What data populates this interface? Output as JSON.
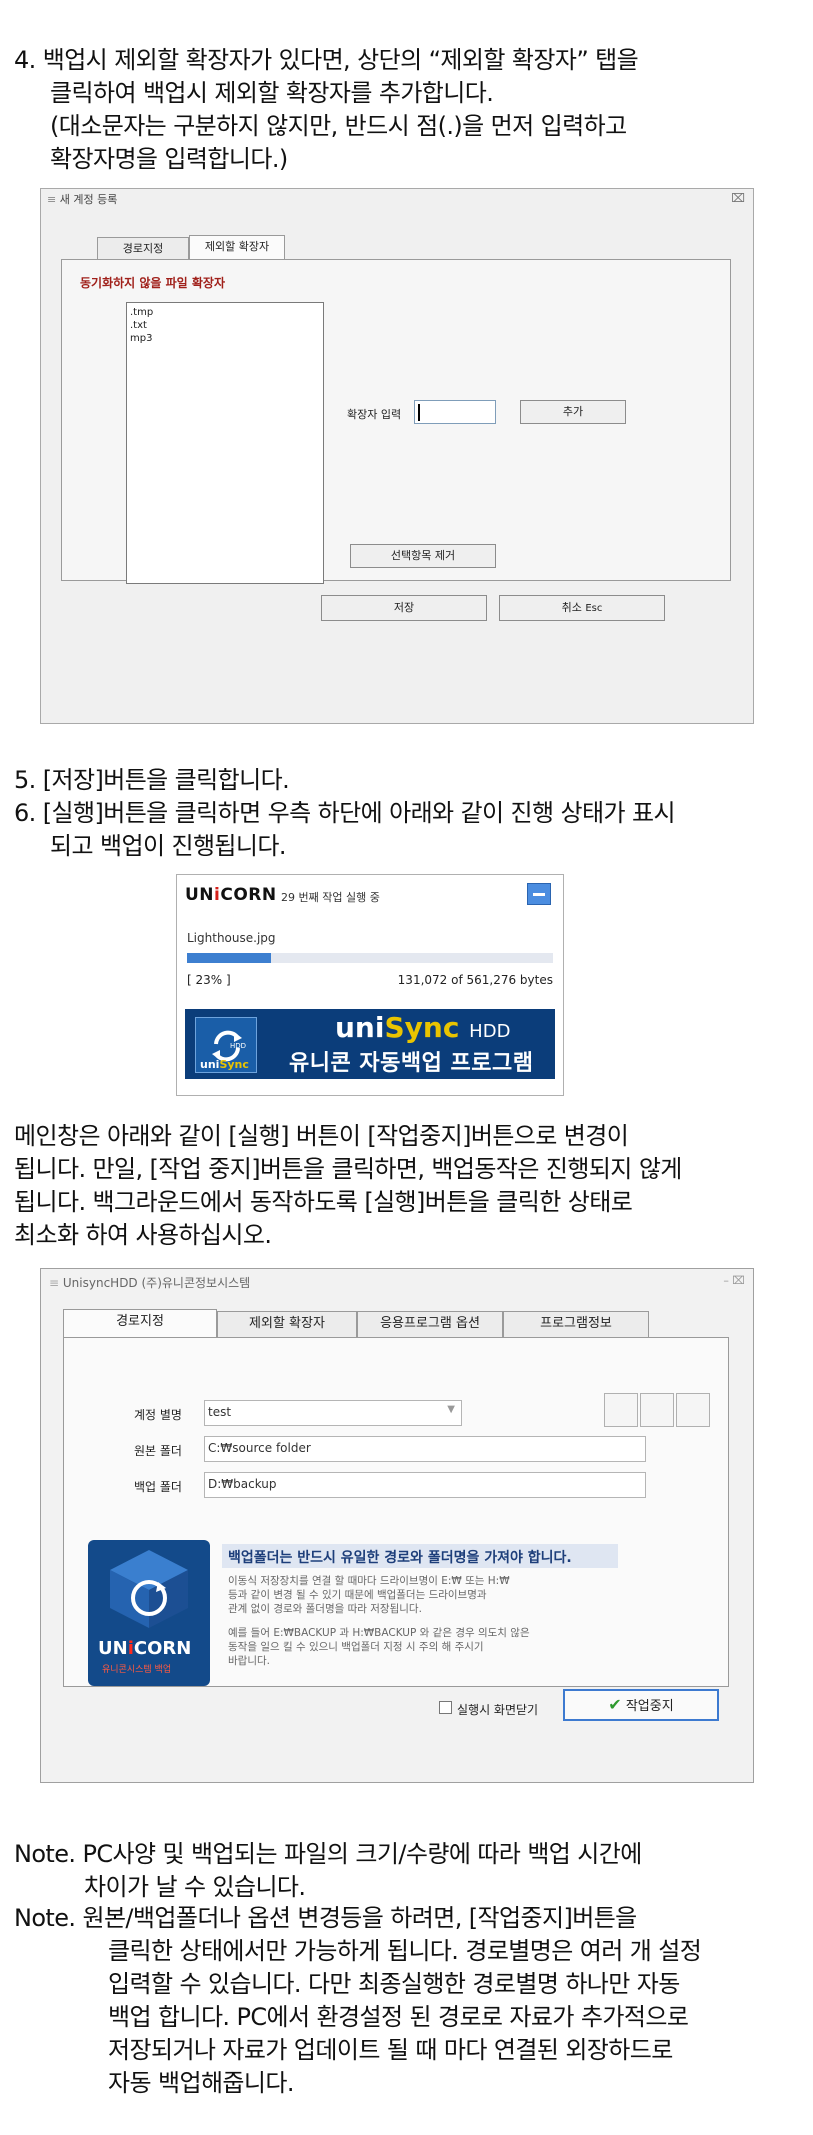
{
  "step4": [
    "4. 백업시 제외할 확장자가 있다면, 상단의 “제외할 확장자” 탭을",
    "클릭하여 백업시 제외할 확장자를 추가합니다.",
    "(대소문자는 구분하지 않지만, 반드시 점(.)을 먼저 입력하고",
    "확장자명을 입력합니다.)"
  ],
  "dialog": {
    "title": "새 계정 등록",
    "close": "⌧",
    "tabs": [
      "경로지정",
      "제외할 확장자"
    ],
    "panel_title": "동기화하지 않을 파일 확장자",
    "extensions": [
      ".tmp",
      ".txt",
      "mp3"
    ],
    "ext_input_label": "확장자 입력",
    "add_button": "추가",
    "remove_button": "선택항목 제거",
    "save_button": "저장",
    "cancel_button": "취소",
    "cancel_key": "Esc"
  },
  "steps56": [
    "5. [저장]버튼을 클릭합니다.",
    "6. [실행]버튼을 클릭하면 우측 하단에 아래와 같이 진행 상태가 표시",
    "되고 백업이 진행됩니다."
  ],
  "progress": {
    "brand_pre": "UN",
    "brand_i": "i",
    "brand_post": "CORN",
    "status": "29 번째 작업 실행 중",
    "file": "Lighthouse.jpg",
    "percent_label": "[ 23% ]",
    "percent": 0.23,
    "bytes": "131,072  of  561,276 bytes",
    "banner_uni": "uni",
    "banner_sync": "Sync",
    "banner_hdd": "HDD",
    "banner_slogan": "유니콘 자동백업 프로그램",
    "banner_small_hdd": "HDD",
    "banner_small_uni": "uni",
    "banner_small_sync": "Sync"
  },
  "main_para": [
    "메인창은 아래와 같이 [실행] 버튼이 [작업중지]버튼으로 변경이",
    "됩니다. 만일, [작업 중지]버튼을 클릭하면, 백업동작은 진행되지 않게",
    "됩니다. 백그라운드에서 동작하도록 [실행]버튼을 클릭한 상태로",
    "최소화 하여 사용하십시오."
  ],
  "main_window": {
    "title": "UnisyncHDD  (주)유니콘정보시스템",
    "controls": "–  ⌧",
    "tabs": [
      "경로지정",
      "제외할 확장자",
      "응용프로그램 옵션",
      "프로그램정보"
    ],
    "account_label": "계정 별명",
    "account_value": "test",
    "source_label": "원본 폴더",
    "source_value": "C:₩source folder",
    "backup_label": "백업 폴더",
    "backup_value": "D:₩backup",
    "logo_pre": "UN",
    "logo_i": "i",
    "logo_post": "CORN",
    "logo_sub": "유니콘시스템 백업",
    "notice_title": "백업폴더는 반드시 유일한 경로와 폴더명을 가져야 합니다.",
    "notice_p1": [
      "이동식 저장장치를 연결 할 때마다 드라이브명이 E:₩ 또는 H:₩",
      "등과 같이 변경 될 수 있기 때문에 백업폴더는 드라이브명과",
      "관계 없이 경로와 폴더명을 따라 저장됩니다."
    ],
    "notice_p2": [
      "예를 들어 E:₩BACKUP 과 H:₩BACKUP 와 같은 경우 의도치 않은",
      "동작을 일으 킬 수 있으니 백업폴더 지정 시 주의 해 주시기",
      "바랍니다."
    ],
    "checkbox_label": "실행시 화면닫기",
    "stop_button": "작업중지"
  },
  "notes": {
    "note1": [
      "Note. PC사양 및 백업되는 파일의 크기/수량에 따라 백업 시간에",
      "차이가 날 수 있습니다."
    ],
    "note2": [
      "Note. 원본/백업폴더나 옵션 변경등을 하려면, [작업중지]버튼을",
      "클릭한 상태에서만 가능하게 됩니다. 경로별명은 여러 개 설정",
      "입력할 수 있습니다. 다만 최종실행한 경로별명 하나만 자동",
      "백업 합니다. PC에서 환경설정 된 경로로 자료가 추가적으로",
      "저장되거나 자료가 업데이트 될 때 마다 연결된 외장하드로",
      "자동 백업해줍니다."
    ]
  }
}
